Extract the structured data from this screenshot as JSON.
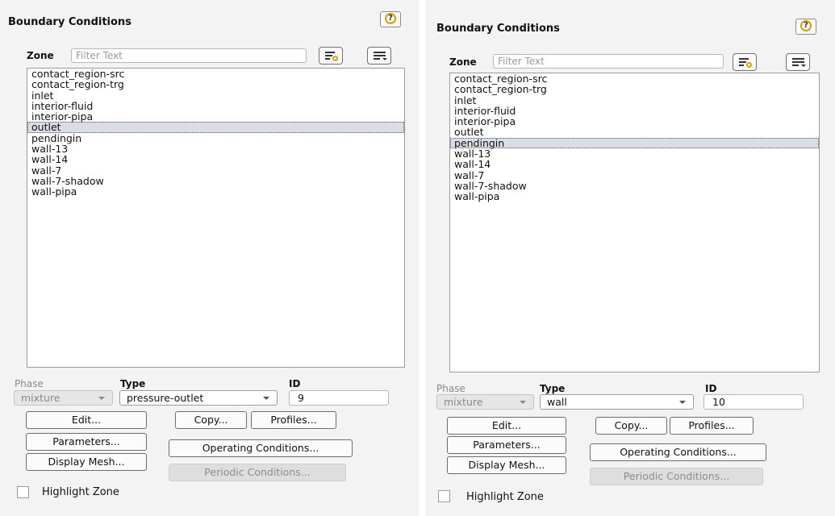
{
  "left": {
    "title": "Boundary Conditions",
    "help_glyph": "?",
    "zone_label": "Zone",
    "filter_placeholder": "Filter Text",
    "zones": [
      "contact_region-src",
      "contact_region-trg",
      "inlet",
      "interior-fluid",
      "interior-pipa",
      "outlet",
      "pendingin",
      "wall-13",
      "wall-14",
      "wall-7",
      "wall-7-shadow",
      "wall-pipa"
    ],
    "selected_zone": "outlet",
    "phase_label": "Phase",
    "phase_value": "mixture",
    "type_label": "Type",
    "type_value": "pressure-outlet",
    "id_label": "ID",
    "id_value": "9",
    "buttons": {
      "edit": "Edit...",
      "copy": "Copy...",
      "profiles": "Profiles...",
      "parameters": "Parameters...",
      "operating": "Operating Conditions...",
      "display_mesh": "Display Mesh...",
      "periodic": "Periodic Conditions..."
    },
    "highlight_label": "Highlight Zone"
  },
  "right": {
    "title": "Boundary Conditions",
    "help_glyph": "?",
    "zone_label": "Zone",
    "filter_placeholder": "Filter Text",
    "zones": [
      "contact_region-src",
      "contact_region-trg",
      "inlet",
      "interior-fluid",
      "interior-pipa",
      "outlet",
      "pendingin",
      "wall-13",
      "wall-14",
      "wall-7",
      "wall-7-shadow",
      "wall-pipa"
    ],
    "selected_zone": "pendingin",
    "phase_label": "Phase",
    "phase_value": "mixture",
    "type_label": "Type",
    "type_value": "wall",
    "id_label": "ID",
    "id_value": "10",
    "buttons": {
      "edit": "Edit...",
      "copy": "Copy...",
      "profiles": "Profiles...",
      "parameters": "Parameters...",
      "operating": "Operating Conditions...",
      "display_mesh": "Display Mesh...",
      "periodic": "Periodic Conditions..."
    },
    "highlight_label": "Highlight Zone"
  }
}
